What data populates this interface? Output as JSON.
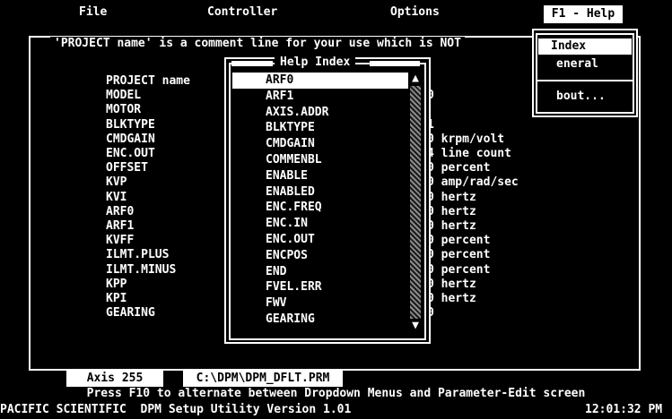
{
  "menubar": {
    "file": "File",
    "controller": "Controller",
    "options": "Options",
    "help": "F1 - Help"
  },
  "comment": "'PROJECT name' is a comment line for your use which is NOT",
  "params": [
    {
      "name": "PROJECT name",
      "value": ""
    },
    {
      "name": "MODEL",
      "value": "0"
    },
    {
      "name": "MOTOR",
      "value": ""
    },
    {
      "name": "BLKTYPE",
      "value": "1"
    },
    {
      "name": "CMDGAIN",
      "value": "0 krpm/volt"
    },
    {
      "name": "ENC.OUT",
      "value": "4 line count"
    },
    {
      "name": "OFFSET",
      "value": "0 percent"
    },
    {
      "name": "KVP",
      "value": "0 amp/rad/sec"
    },
    {
      "name": "KVI",
      "value": "0 hertz"
    },
    {
      "name": "ARF0",
      "value": "0 hertz"
    },
    {
      "name": "ARF1",
      "value": "0 hertz"
    },
    {
      "name": "KVFF",
      "value": "0 percent"
    },
    {
      "name": "ILMT.PLUS",
      "value": "0 percent"
    },
    {
      "name": "ILMT.MINUS",
      "value": "0 percent"
    },
    {
      "name": "KPP",
      "value": "0 hertz"
    },
    {
      "name": "KPI",
      "value": "0 hertz"
    },
    {
      "name": "GEARING",
      "value": "0"
    }
  ],
  "help_menu": {
    "items": [
      "Index",
      "eneral",
      "bout..."
    ]
  },
  "help_index": {
    "title": "Help Index",
    "items": [
      "ARF0",
      "ARF1",
      "AXIS.ADDR",
      "BLKTYPE",
      "CMDGAIN",
      "COMMENBL",
      "ENABLE",
      "ENABLED",
      "ENC.FREQ",
      "ENC.IN",
      "ENC.OUT",
      "ENCPOS",
      "END",
      "FVEL.ERR",
      "FWV",
      "GEARING"
    ],
    "selected_index": 0,
    "scroll_up": "▲",
    "scroll_down": "▼"
  },
  "status": {
    "axis": "Axis 255",
    "path": "C:\\DPM\\DPM_DFLT.PRM",
    "hint": "Press F10 to alternate between Dropdown Menus and Parameter-Edit screen",
    "app": "PACIFIC SCIENTIFIC  DPM Setup Utility Version 1.01",
    "time": "12:01:32 PM"
  },
  "colors": {
    "background": "#000000",
    "foreground": "#ffffff"
  }
}
